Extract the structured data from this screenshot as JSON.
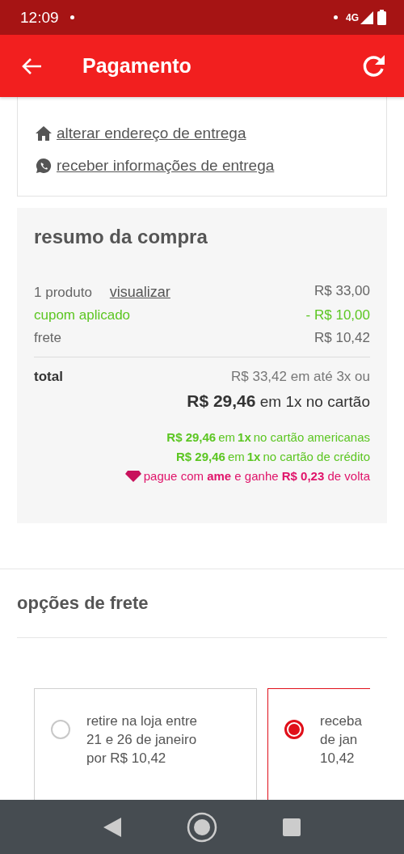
{
  "status_bar": {
    "time": "12:09",
    "network": "4G"
  },
  "app_bar": {
    "title": "Pagamento"
  },
  "address_links": [
    {
      "kind": "home",
      "label": "alterar endereço de entrega"
    },
    {
      "kind": "chat",
      "label": "receber informações de entrega"
    }
  ],
  "summary": {
    "title": "resumo da compra",
    "rows": [
      {
        "kind": "product",
        "label": "1 produto",
        "link": "visualizar",
        "value": "R$ 33,00"
      },
      {
        "kind": "discount",
        "label": "cupom aplicado",
        "value": "- R$ 10,00"
      },
      {
        "kind": "plain",
        "label": "frete",
        "value": "R$ 10,42"
      }
    ],
    "total": {
      "label": "total",
      "installments": "R$ 33,42 em até 3x ou",
      "single": "**R$ 29,46** em 1x no cartão"
    },
    "offers": [
      {
        "kind": "card",
        "text": "**R$ 29,46** em **1x** no cartão americanas"
      },
      {
        "kind": "card",
        "text": "**R$ 29,46** em **1x** no cartão de crédito"
      },
      {
        "kind": "ame",
        "text": "pague com **ame** e ganhe **R$ 0,23** de volta"
      }
    ]
  },
  "shipping": {
    "title": "opções de frete",
    "options": [
      {
        "lines": [
          "retire na loja entre",
          "21 e 26 de janeiro",
          "por R$ 10,42"
        ],
        "selected": false
      },
      {
        "lines": [
          "receba",
          "de jan",
          "10,42"
        ],
        "selected": true
      }
    ]
  }
}
